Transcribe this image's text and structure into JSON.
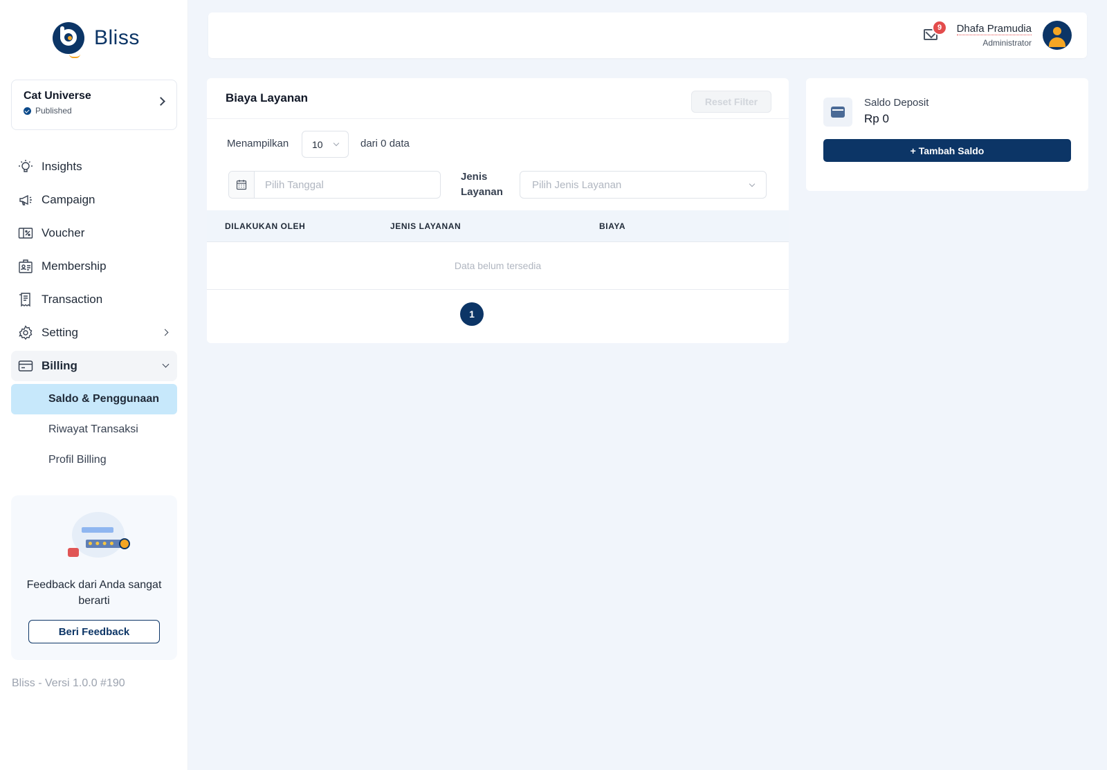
{
  "brand": {
    "name": "Bliss"
  },
  "store": {
    "name": "Cat Universe",
    "status": "Published"
  },
  "nav": {
    "items": [
      {
        "label": "Insights",
        "icon": "lightbulb-icon"
      },
      {
        "label": "Campaign",
        "icon": "megaphone-icon"
      },
      {
        "label": "Voucher",
        "icon": "voucher-icon"
      },
      {
        "label": "Membership",
        "icon": "membership-card-icon"
      },
      {
        "label": "Transaction",
        "icon": "receipt-icon"
      },
      {
        "label": "Setting",
        "icon": "gear-icon"
      },
      {
        "label": "Billing",
        "icon": "credit-card-icon"
      }
    ],
    "billing_sub": [
      {
        "label": "Saldo & Penggunaan",
        "active": true
      },
      {
        "label": "Riwayat Transaksi",
        "active": false
      },
      {
        "label": "Profil Billing",
        "active": false
      }
    ]
  },
  "feedback": {
    "text": "Feedback dari Anda sangat berarti",
    "button": "Beri Feedback"
  },
  "version": "Bliss - Versi 1.0.0 #190",
  "header": {
    "notification_count": "9",
    "user_name": "Dhafa Pramudia",
    "user_role": "Administrator"
  },
  "service_fee": {
    "title": "Biaya Layanan",
    "reset_filter": "Reset Filter",
    "show_label": "Menampilkan",
    "page_size": "10",
    "of_data": "dari 0 data",
    "date_placeholder": "Pilih Tanggal",
    "service_type_label": "Jenis Layanan",
    "service_type_placeholder": "Pilih Jenis Layanan",
    "columns": [
      "DILAKUKAN OLEH",
      "JENIS LAYANAN",
      "BIAYA"
    ],
    "empty_text": "Data belum tersedia",
    "current_page": "1"
  },
  "deposit": {
    "label": "Saldo Deposit",
    "value": "Rp 0",
    "topup_button": "+ Tambah Saldo"
  },
  "colors": {
    "primary": "#0c3566",
    "accent": "#f5a623",
    "active_sub_bg": "#c7e8fb",
    "badge": "#e34c4c",
    "page_bg": "#f1f5fb"
  }
}
